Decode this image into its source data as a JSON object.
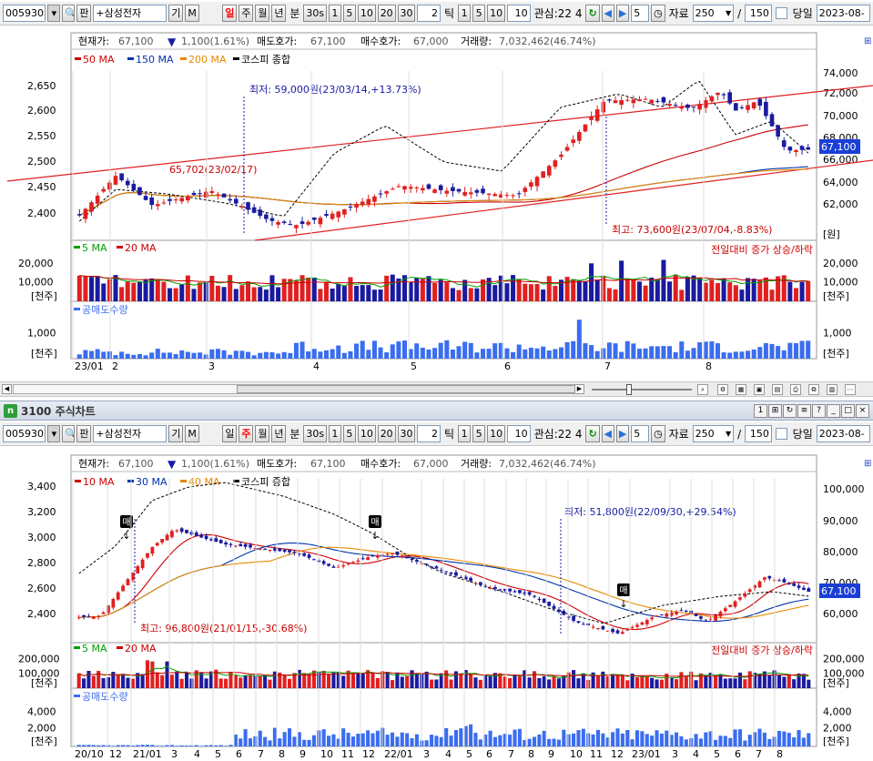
{
  "toolbar": {
    "stock_code": "005930",
    "search_label": "판",
    "stock_name": "+삼성전자",
    "gi_label": "기",
    "m_label": "M",
    "period_day": "일",
    "period_week": "주",
    "period_month": "월",
    "period_year": "년",
    "period_min": "분",
    "period_sec": "30s",
    "min_buttons": [
      "1",
      "5",
      "10",
      "20",
      "30"
    ],
    "tick_value": "2",
    "tick_label": "틱",
    "tick_buttons": [
      "1",
      "5",
      "10"
    ],
    "tick_last": "10",
    "interest_label": "관심:22 4",
    "refresh_icon": "refresh-icon",
    "step_value": "5",
    "data_label": "자료",
    "data_count": "250",
    "slash": "/",
    "total_count": "150",
    "today_label": "당일",
    "date_value": "2023-08-"
  },
  "panel": {
    "logo": "n",
    "title": "3100 주식차트",
    "buttons": [
      "1",
      "⊞",
      "↻",
      "≡",
      "?",
      "_",
      "□",
      "×"
    ]
  },
  "colors": {
    "up": "#e02020",
    "down": "#1a1aa0",
    "ma50": "#cc0000",
    "ma150": "#0033aa",
    "ma200": "#e88a00",
    "kospi": "#000000",
    "short": "#3a6df0",
    "vol_ma5": "#00a000",
    "vol_ma20": "#cc0000",
    "trend": "#e02020",
    "price_box": "#1a3fd6"
  },
  "chart_data": [
    {
      "type": "candlestick",
      "id": "weekly-chart",
      "info": {
        "price_label": "현재가:",
        "price": "67,100",
        "change": "1,100(1.61%)",
        "ask_label": "매도호가:",
        "ask": "67,100",
        "bid_label": "매수호가:",
        "bid": "67,000",
        "vol_label": "거래량:",
        "volume": "7,032,462(46.74%)"
      },
      "legend": [
        "50 MA",
        "150 MA",
        "200 MA",
        "코스피 종합"
      ],
      "left_axis_ticks": [
        "2,650",
        "2,600",
        "2,550",
        "2,500",
        "2,450",
        "2,400"
      ],
      "right_axis_ticks": [
        "74,000",
        "72,000",
        "70,000",
        "68,000",
        "66,000",
        "64,000",
        "62,000"
      ],
      "right_unit": "[원]",
      "current_price": "67,100",
      "x_labels": [
        "23/01",
        "2",
        "3",
        "4",
        "5",
        "6",
        "7",
        "8"
      ],
      "annotations": {
        "low_label": "최저: 59,000원(23/03/14,+13.73%)",
        "high_label": "최고: 73,600원(23/07/04,-8.83%)",
        "mid_label": "65,702(23/02/17)"
      },
      "volume": {
        "legend": [
          "5 MA",
          "20 MA"
        ],
        "note": "전일대비 증가 상승/하락",
        "ticks": [
          "20,000",
          "10,000"
        ],
        "unit": "[천주]"
      },
      "short": {
        "legend": "공매도수량",
        "ticks": [
          "1,000"
        ],
        "unit": "[천주]"
      },
      "price_range": [
        58000,
        75000
      ],
      "kospi_range": [
        2350,
        2690
      ]
    },
    {
      "type": "candlestick",
      "id": "long-chart",
      "info": {
        "price_label": "현재가:",
        "price": "67,100",
        "change": "1,100(1.61%)",
        "ask_label": "매도호가:",
        "ask": "67,100",
        "bid_label": "매수호가:",
        "bid": "67,000",
        "vol_label": "거래량:",
        "volume": "7,032,462(46.74%)"
      },
      "legend": [
        "10 MA",
        "30 MA",
        "40 MA",
        "코스피 종합"
      ],
      "left_axis_ticks": [
        "3,400",
        "3,200",
        "3,000",
        "2,800",
        "2,600",
        "2,400"
      ],
      "right_axis_ticks": [
        "100,000",
        "90,000",
        "80,000",
        "70,000",
        "60,000"
      ],
      "current_price": "67,100",
      "x_labels": [
        "20/10",
        "12",
        "21/01",
        "3",
        "4",
        "5",
        "6",
        "7",
        "8",
        "9",
        "10",
        "11",
        "12",
        "22/01",
        "3",
        "4",
        "5",
        "6",
        "7",
        "8",
        "9",
        "10",
        "11",
        "12",
        "23/01",
        "3",
        "4",
        "5",
        "6",
        "7",
        "8"
      ],
      "annotations": {
        "low_label": "최저: 51,800원(22/09/30,+29.54%)",
        "high_label": "최고: 96,800원(21/01/15,-30.68%)",
        "sell_markers": [
          "매",
          "매",
          "매"
        ]
      },
      "volume": {
        "legend": [
          "5 MA",
          "20 MA"
        ],
        "note": "전일대비 증가 상승/하락",
        "ticks": [
          "200,000",
          "100,000"
        ],
        "unit": "[천주]"
      },
      "short": {
        "legend": "공매도수량",
        "ticks": [
          "4,000",
          "2,000"
        ],
        "unit": "[천주]"
      },
      "price_range": [
        50000,
        105000
      ],
      "kospi_range": [
        2260,
        3420
      ]
    }
  ]
}
